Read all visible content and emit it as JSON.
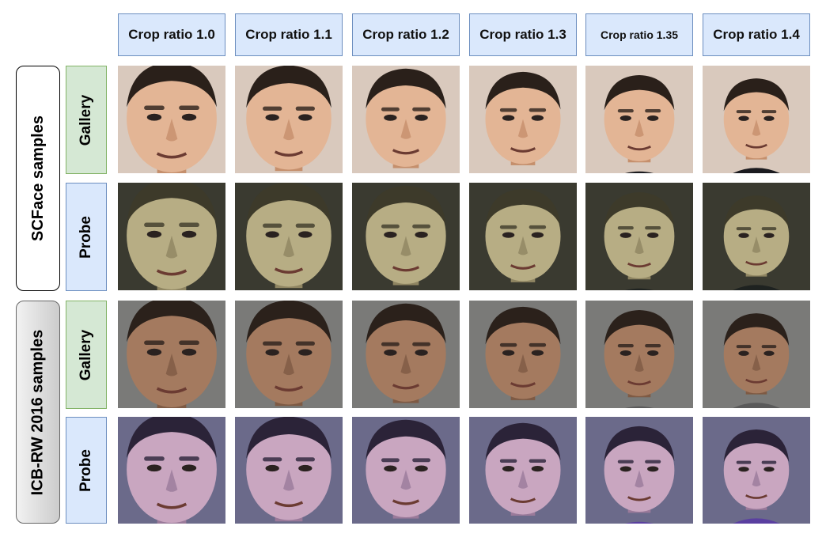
{
  "columns": [
    "Crop ratio 1.0",
    "Crop ratio 1.1",
    "Crop ratio 1.2",
    "Crop ratio 1.3",
    "Crop ratio 1.35",
    "Crop ratio 1.4"
  ],
  "groups": [
    {
      "label": "SCFace samples",
      "rows": [
        "Gallery",
        "Probe"
      ]
    },
    {
      "label": "ICB-RW 2016 samples",
      "rows": [
        "Gallery",
        "Probe"
      ]
    }
  ],
  "colors": {
    "header_fill": "#dae8fc",
    "header_border": "#6c8ebf",
    "gallery_fill": "#d5e8d4",
    "gallery_border": "#82b366",
    "probe_fill": "#dae8fc",
    "probe_border": "#6c8ebf"
  }
}
